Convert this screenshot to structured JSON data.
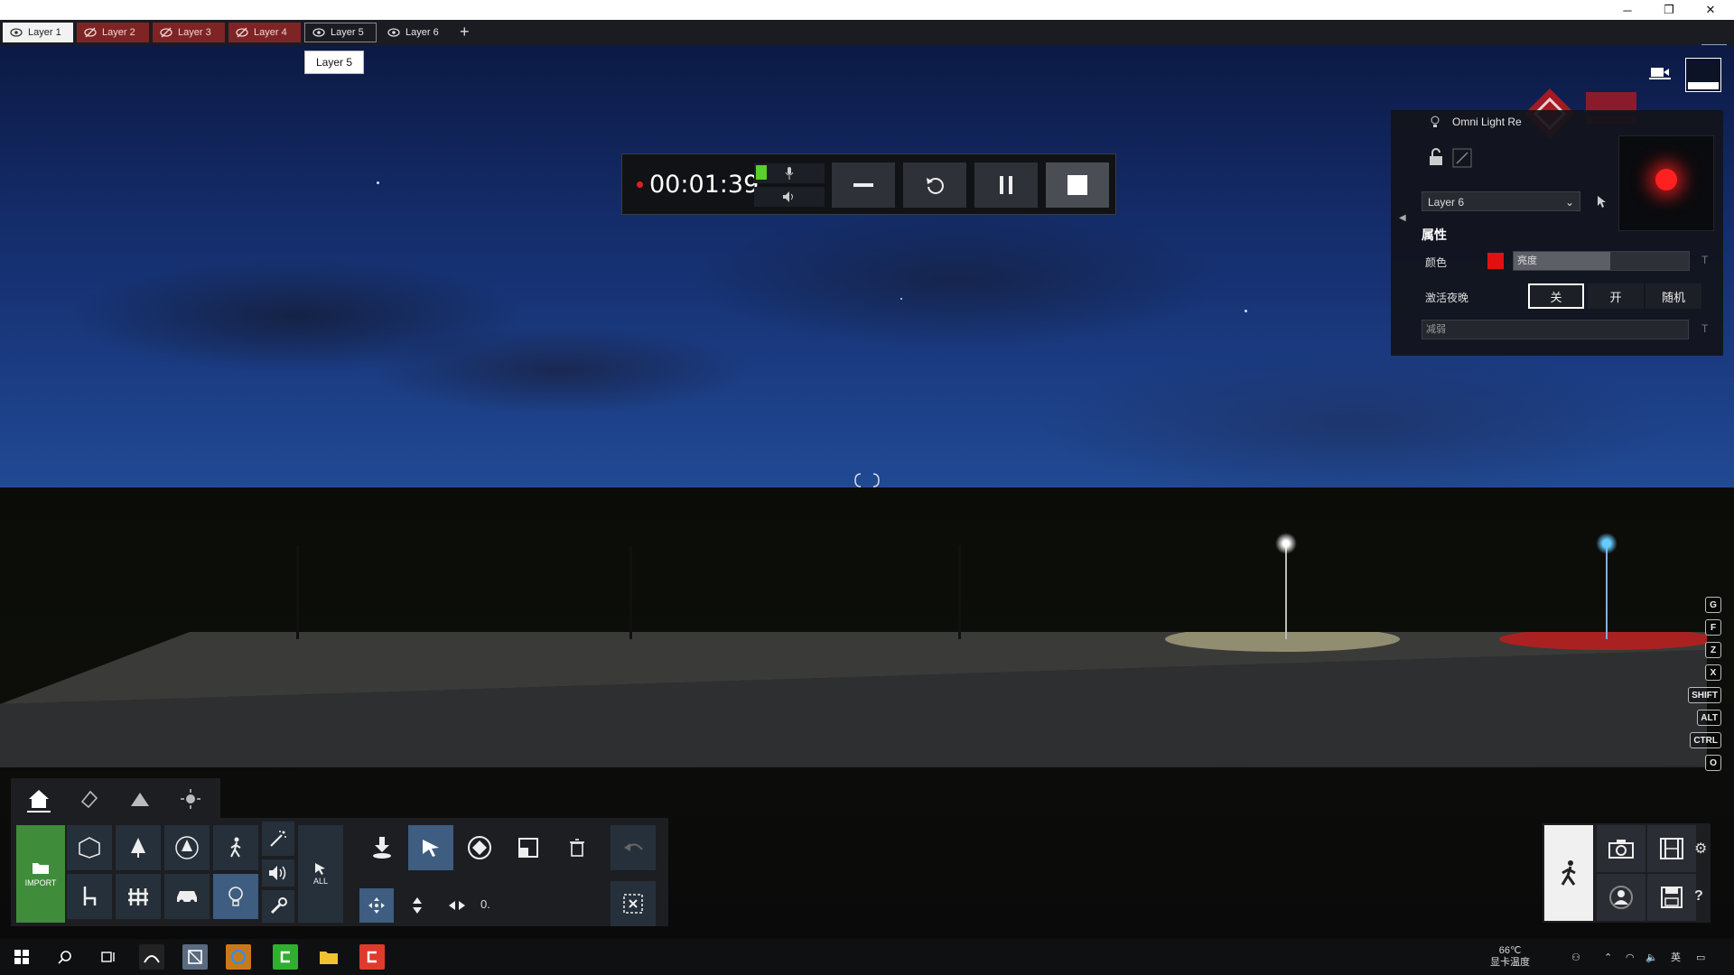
{
  "window": {
    "minimize": "─",
    "maximize": "❐",
    "close": "✕"
  },
  "tabs": [
    {
      "label": "Layer 1",
      "state": "visible"
    },
    {
      "label": "Layer 2",
      "state": "hidden"
    },
    {
      "label": "Layer 3",
      "state": "hidden"
    },
    {
      "label": "Layer 4",
      "state": "hidden"
    },
    {
      "label": "Layer 5",
      "state": "visible"
    },
    {
      "label": "Layer 6",
      "state": "visible"
    }
  ],
  "add_tab": "+",
  "tooltip": "Layer 5",
  "recorder": {
    "time": "00:01:39"
  },
  "panel": {
    "title": "Omni Light Re",
    "layer_select": "Layer 6",
    "props_header": "属性",
    "color_label": "颜色",
    "brightness_label": "亮度",
    "brightness_fraction": 0.55,
    "night_label": "激活夜晚",
    "options": [
      "关",
      "开",
      "随机"
    ],
    "selected_option": "关",
    "attenuation_label": "减弱",
    "t_marker": "T",
    "light_color": "#ff2020"
  },
  "shortcut_keys": [
    "G",
    "F",
    "Z",
    "X",
    "SHIFT",
    "ALT",
    "CTRL",
    "O"
  ],
  "toolbar": {
    "import_label": "IMPORT",
    "all_label": "ALL",
    "value_field": "0."
  },
  "taskbar": {
    "temp": "66℃",
    "temp_label": "显卡温度",
    "ime": "英"
  },
  "colors": {
    "accent": "#3f8d3a",
    "hidden_tab": "#7e2424",
    "selected_tool": "#3e5d80"
  }
}
